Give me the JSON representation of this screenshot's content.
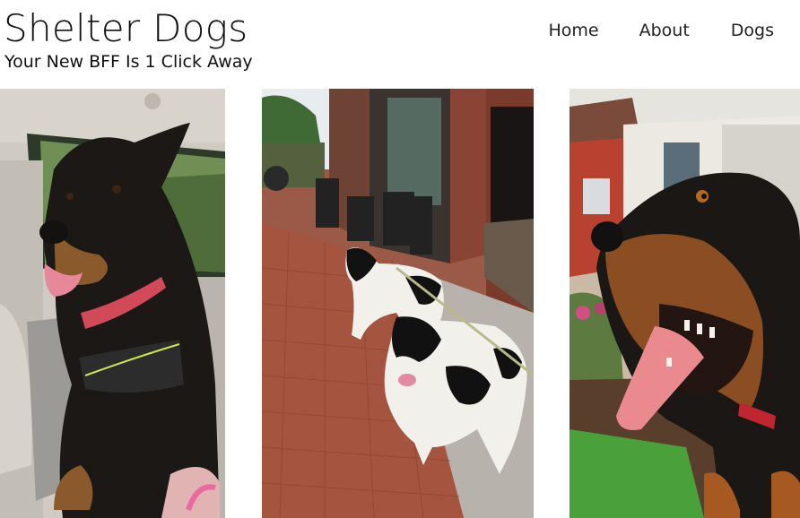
{
  "header": {
    "title": "Shelter Dogs",
    "tagline": "Your New BFF Is 1 Click Away"
  },
  "nav": {
    "items": [
      {
        "label": "Home"
      },
      {
        "label": "About"
      },
      {
        "label": "Dogs"
      }
    ]
  },
  "gallery": {
    "photos": [
      {
        "subject": "black-tan-dog-in-car"
      },
      {
        "subject": "two-black-white-dogs-on-sidewalk"
      },
      {
        "subject": "rottweiler-closeup-tongue-out"
      }
    ]
  },
  "colors": {
    "background": "#ffffff",
    "text": "#111111"
  }
}
